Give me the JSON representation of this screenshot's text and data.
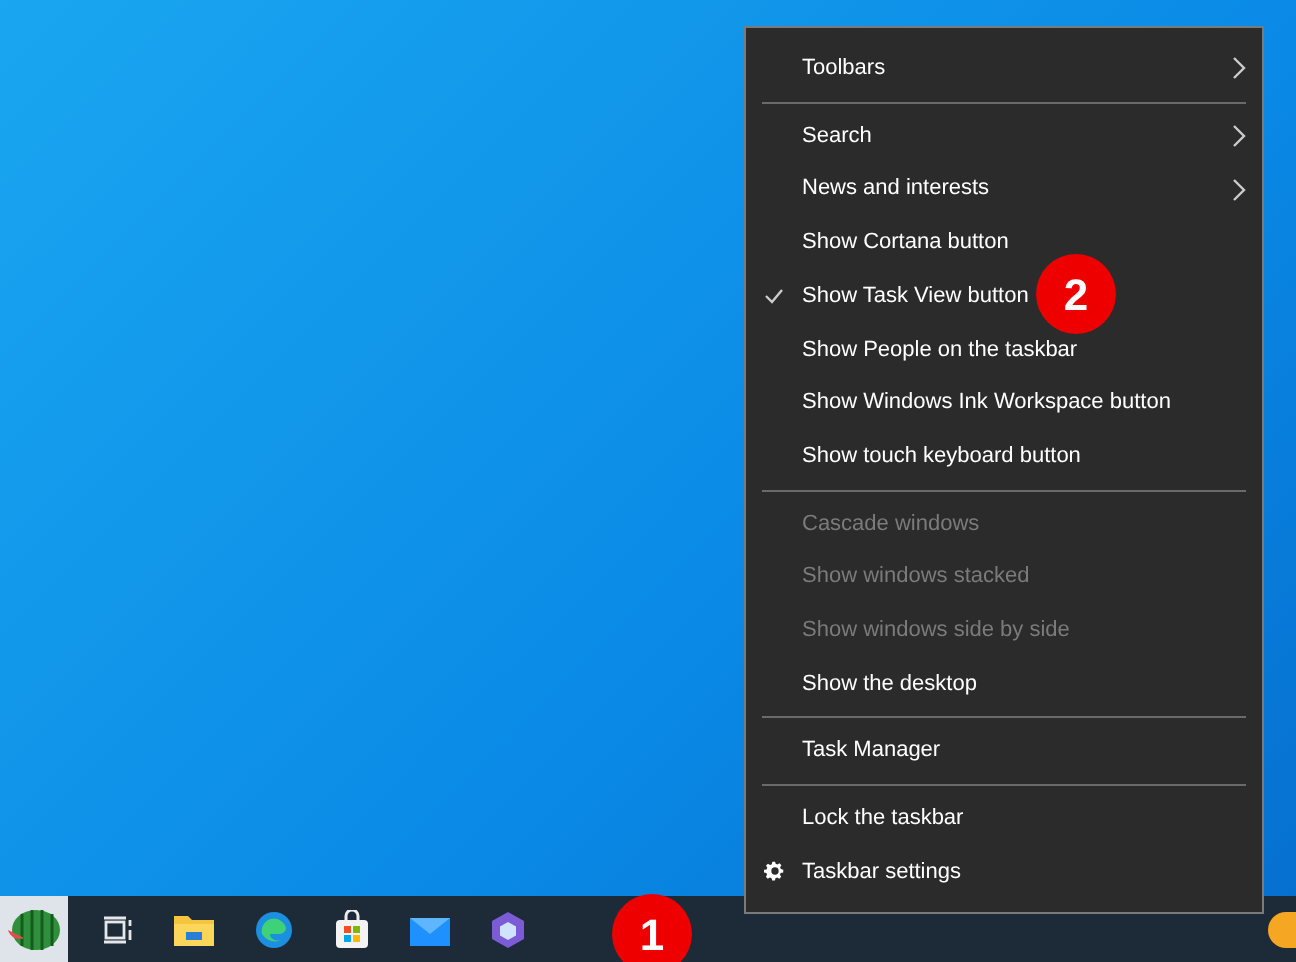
{
  "context_menu": {
    "items": [
      {
        "kind": "item",
        "label": "Toolbars",
        "submenu": true,
        "checked": false,
        "disabled": false
      },
      {
        "kind": "separator"
      },
      {
        "kind": "item",
        "label": "Search",
        "submenu": true,
        "checked": false,
        "disabled": false
      },
      {
        "kind": "item",
        "label": "News and interests",
        "submenu": true,
        "checked": false,
        "disabled": false
      },
      {
        "kind": "item",
        "label": "Show Cortana button",
        "submenu": false,
        "checked": false,
        "disabled": false
      },
      {
        "kind": "item",
        "label": "Show Task View button",
        "submenu": false,
        "checked": true,
        "disabled": false
      },
      {
        "kind": "item",
        "label": "Show People on the taskbar",
        "submenu": false,
        "checked": false,
        "disabled": false
      },
      {
        "kind": "item",
        "label": "Show Windows Ink Workspace button",
        "submenu": false,
        "checked": false,
        "disabled": false
      },
      {
        "kind": "item",
        "label": "Show touch keyboard button",
        "submenu": false,
        "checked": false,
        "disabled": false
      },
      {
        "kind": "separator"
      },
      {
        "kind": "item",
        "label": "Cascade windows",
        "submenu": false,
        "checked": false,
        "disabled": true
      },
      {
        "kind": "item",
        "label": "Show windows stacked",
        "submenu": false,
        "checked": false,
        "disabled": true
      },
      {
        "kind": "item",
        "label": "Show windows side by side",
        "submenu": false,
        "checked": false,
        "disabled": true
      },
      {
        "kind": "item",
        "label": "Show the desktop",
        "submenu": false,
        "checked": false,
        "disabled": false
      },
      {
        "kind": "separator"
      },
      {
        "kind": "item",
        "label": "Task Manager",
        "submenu": false,
        "checked": false,
        "disabled": false
      },
      {
        "kind": "separator"
      },
      {
        "kind": "item",
        "label": "Lock the taskbar",
        "submenu": false,
        "checked": false,
        "disabled": false
      },
      {
        "kind": "settings",
        "label": "Taskbar settings",
        "submenu": false,
        "checked": false,
        "disabled": false
      }
    ]
  },
  "annotations": [
    {
      "label": "1"
    },
    {
      "label": "2"
    }
  ]
}
